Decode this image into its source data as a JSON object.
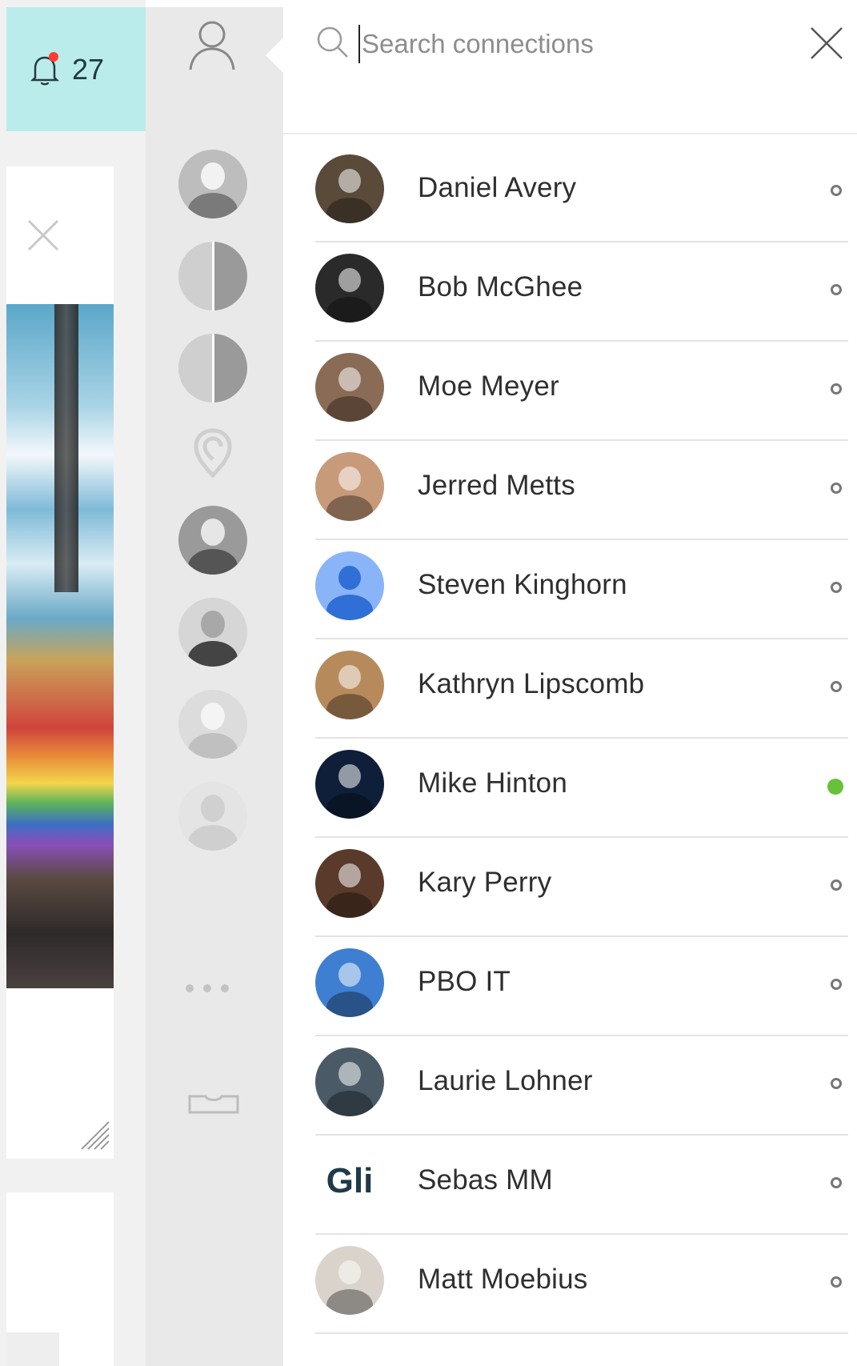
{
  "notifications": {
    "count": "27",
    "icon": "bell-icon"
  },
  "search": {
    "placeholder": "Search connections"
  },
  "rail": {
    "items": [
      {
        "icon": "profile-icon"
      },
      {
        "icon": "avatar"
      },
      {
        "icon": "group-avatar"
      },
      {
        "icon": "group-avatar"
      },
      {
        "icon": "location-pin-icon"
      },
      {
        "icon": "avatar"
      },
      {
        "icon": "avatar"
      },
      {
        "icon": "avatar"
      },
      {
        "icon": "avatar"
      },
      {
        "icon": "more-icon"
      },
      {
        "icon": "tray-icon"
      }
    ]
  },
  "connections": [
    {
      "name": "Daniel Avery",
      "status": "offline",
      "avatar_color": "#5a4a3a"
    },
    {
      "name": "Bob McGhee",
      "status": "offline",
      "avatar_color": "#2a2a2a"
    },
    {
      "name": "Moe Meyer",
      "status": "offline",
      "avatar_color": "#8a6b55"
    },
    {
      "name": "Jerred Metts",
      "status": "offline",
      "avatar_color": "#c79a7a"
    },
    {
      "name": "Steven Kinghorn",
      "status": "offline",
      "avatar_color": "#8ab4f8"
    },
    {
      "name": "Kathryn Lipscomb",
      "status": "offline",
      "avatar_color": "#b78a5c"
    },
    {
      "name": "Mike Hinton",
      "status": "online",
      "avatar_color": "#0f1f3a"
    },
    {
      "name": "Kary Perry",
      "status": "offline",
      "avatar_color": "#5a3a2a"
    },
    {
      "name": "PBO IT",
      "status": "offline",
      "avatar_color": "#3f7fd1"
    },
    {
      "name": "Laurie Lohner",
      "status": "offline",
      "avatar_color": "#4a5a66"
    },
    {
      "name": "Sebas MM",
      "status": "offline",
      "avatar_text": "Gli"
    },
    {
      "name": "Matt Moebius",
      "status": "offline",
      "avatar_color": "#d9d3cb"
    }
  ],
  "colors": {
    "online": "#67c23a",
    "notification_bg": "#b9ecea",
    "badge": "#ff3b30"
  }
}
